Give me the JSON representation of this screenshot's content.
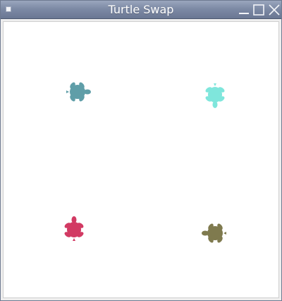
{
  "window": {
    "title": "Turtle Swap",
    "menu_icon": "window-menu-icon",
    "controls": [
      "minimize-icon",
      "maximize-icon",
      "close-icon"
    ]
  },
  "canvas": {
    "background": "#ffffff",
    "turtles": [
      {
        "name": "turtle-teal",
        "color": "#5f9ea8",
        "heading": "east"
      },
      {
        "name": "turtle-aqua",
        "color": "#7fe6dc",
        "heading": "south"
      },
      {
        "name": "turtle-crimson",
        "color": "#d23a63",
        "heading": "north"
      },
      {
        "name": "turtle-olive",
        "color": "#7f7a4e",
        "heading": "west"
      }
    ]
  }
}
